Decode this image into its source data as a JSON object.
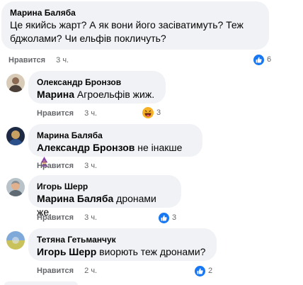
{
  "comments": [
    {
      "author": "Марина Баляба",
      "text": "Це якийсь жарт? А як вони його засіватимуть? Теж бджолами? Чи ельфів покличуть?",
      "like_label": "Нравится",
      "time": "3 ч.",
      "reaction": {
        "icon": "like-icon",
        "count": "6"
      }
    },
    {
      "author": "Олександр Бронзов",
      "mention": "Марина",
      "text": "Агроельфів жиж.",
      "like_label": "Нравится",
      "time": "3 ч.",
      "reaction": {
        "icon": "haha-icon",
        "count": "3"
      }
    },
    {
      "author": "Марина Баляба",
      "mention": "Александр Бронзов",
      "text": "не інакше",
      "emoji": "woman-mage-emoji",
      "like_label": "Нравится",
      "time": "3 ч."
    },
    {
      "author": "Игорь Шерр",
      "mention": "Марина Баляба",
      "text": "дронами же.",
      "like_label": "Нравится",
      "time": "3 ч.",
      "reaction": {
        "icon": "like-icon",
        "count": "3"
      }
    },
    {
      "author": "Тетяна Гетьманчук",
      "mention": "Игорь Шерр",
      "text": "виорють теж дронами?",
      "like_label": "Нравится",
      "time": "2 ч.",
      "reaction": {
        "icon": "like-icon",
        "count": "2"
      }
    }
  ],
  "colors": {
    "like_blue": "#1877f2",
    "haha_yellow": "#f7b125",
    "bubble_bg": "#f0f2f5",
    "meta_gray": "#65676b"
  }
}
